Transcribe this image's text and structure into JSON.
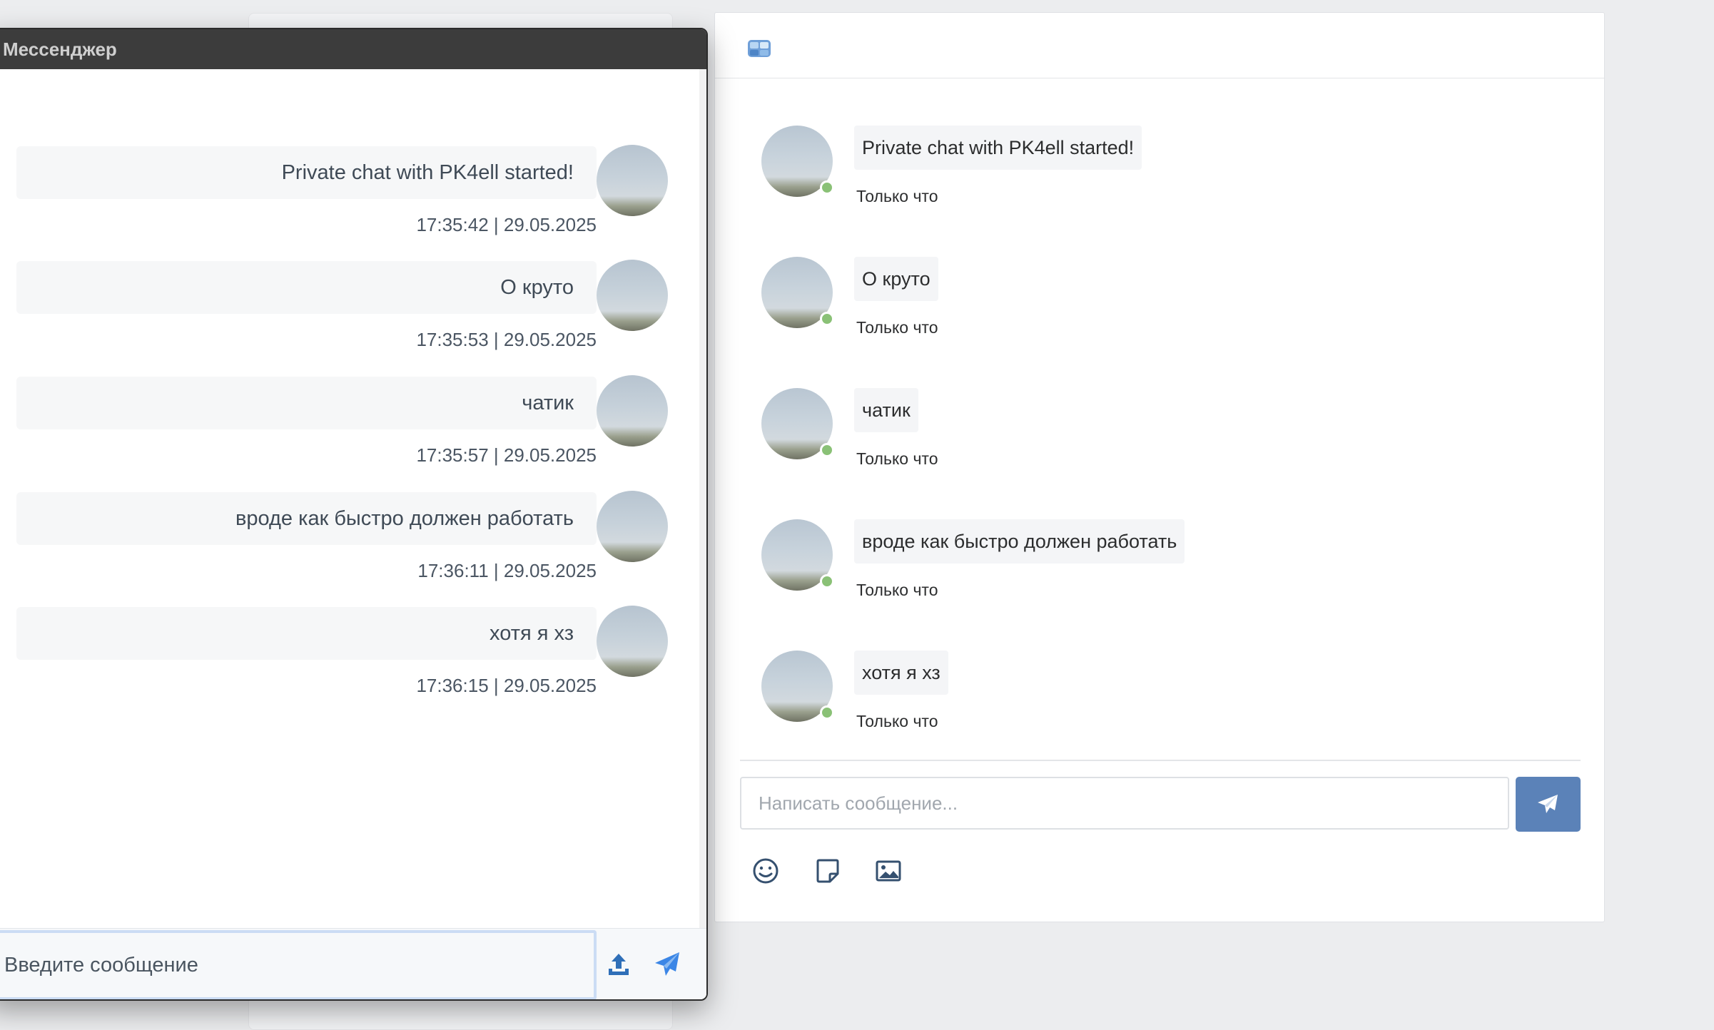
{
  "messenger": {
    "title": "Мессенджер",
    "input_placeholder": "Введите сообщение",
    "messages": [
      {
        "text": "Private chat with PK4ell started!",
        "time": "17:35:42 | 29.05.2025"
      },
      {
        "text": "О круто",
        "time": "17:35:53 | 29.05.2025"
      },
      {
        "text": "чатик",
        "time": "17:35:57 | 29.05.2025"
      },
      {
        "text": "вроде как быстро должен работать",
        "time": "17:36:11 | 29.05.2025"
      },
      {
        "text": "хотя я хз",
        "time": "17:36:15 | 29.05.2025"
      }
    ]
  },
  "vk_chat": {
    "header_icon": "app-cube-icon",
    "input_placeholder": "Написать сообщение...",
    "messages": [
      {
        "text": "Private chat with PK4ell started!",
        "time": "Только что"
      },
      {
        "text": "О круто",
        "time": "Только что"
      },
      {
        "text": "чатик",
        "time": "Только что"
      },
      {
        "text": "вроде как быстро должен работать",
        "time": "Только что"
      },
      {
        "text": "хотя я хз",
        "time": "Только что"
      }
    ],
    "tools": [
      "emoji-icon",
      "sticker-icon",
      "image-icon"
    ],
    "accent_color": "#5b82b8",
    "online_color": "#8ac176"
  }
}
